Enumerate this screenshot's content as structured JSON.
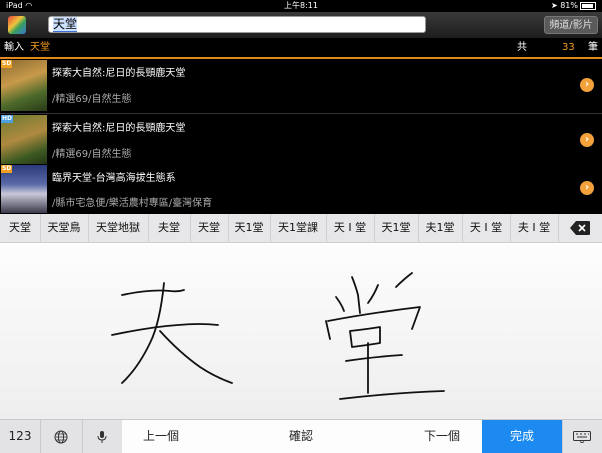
{
  "status": {
    "device": "iPad",
    "wifi_icon": "wifi-icon",
    "time": "上午8:11",
    "battery": "81%"
  },
  "topbar": {
    "search_value": "天堂",
    "mode_button": "頻道/影片"
  },
  "info": {
    "input_label": "輸入",
    "query": "天堂",
    "total_label": "共",
    "count": "33",
    "unit": "筆"
  },
  "results": [
    {
      "quality": "SD",
      "title": "探索大自然:尼日的長頸鹿天堂",
      "subtitle": "/精選69/自然生態"
    },
    {
      "quality": "HD",
      "title": "探索大自然:尼日的長頸鹿天堂",
      "subtitle": "/精選69/自然生態"
    },
    {
      "quality": "SD",
      "title": "臨界天堂-台灣高海拔生態系",
      "subtitle": "/縣市宅急便/樂活農村專區/臺灣保育"
    }
  ],
  "keyboard": {
    "candidates": [
      "天堂",
      "天堂鳥",
      "天堂地獄",
      "夫堂",
      "天堂",
      "天1堂",
      "天1堂課",
      "天 I 堂",
      "天1堂",
      "夫1堂",
      "天 I 堂",
      "夫 I 堂"
    ],
    "keys": {
      "numbers": "123",
      "prev": "上一個",
      "confirm": "確認",
      "next": "下一個",
      "done": "完成"
    }
  }
}
